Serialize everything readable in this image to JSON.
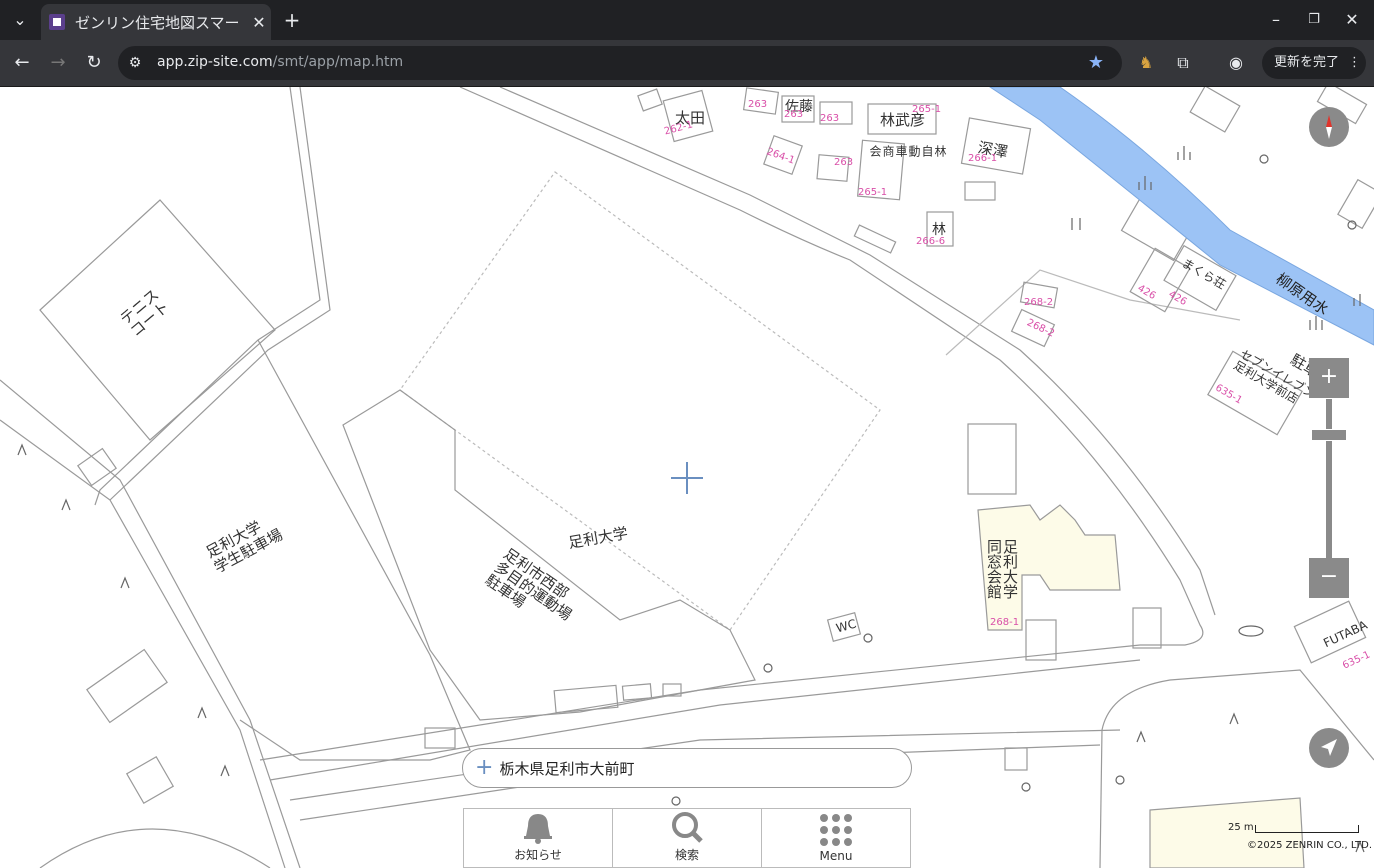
{
  "browser": {
    "tab_title": "ゼンリン住宅地図スマー",
    "url_host": "app.zip-site.com",
    "url_path": "/smt/app/map.htm",
    "update_label": "更新を完了"
  },
  "map": {
    "labels": {
      "tennis": "テニス\nコート",
      "parking": "足利大学\n学生駐車場",
      "university": "足利大学",
      "sports": "足利市西部\n多目的運動場\n駐車場",
      "alumni": "足利大学\n同窓会館",
      "ota": "太田",
      "sato": "佐藤",
      "hayashi_takehiko": "林武彦",
      "hayashi_shokai": "林\n自\n動\n車\n商\n会",
      "fukasawa": "深澤",
      "hayashi": "林",
      "seven": "セブンイレブン\n足利大学前店",
      "futaba": "FUTABA",
      "makura": "まくら荘",
      "wc": "WC",
      "canal": "柳原用水",
      "parking_right": "駐車"
    },
    "lot_numbers": [
      "262-1",
      "263",
      "263",
      "263",
      "263",
      "264-1",
      "263",
      "265-1",
      "265-1",
      "266-1",
      "266-6",
      "268-2",
      "268-2",
      "268-1",
      "426",
      "426",
      "635-1",
      "635-1"
    ]
  },
  "controls": {
    "zoom_in": "+",
    "zoom_out": "−"
  },
  "address": {
    "text": "栃木県足利市大前町"
  },
  "bottom_nav": {
    "notice": "お知らせ",
    "search": "検索",
    "menu": "Menu"
  },
  "scale": "25 m",
  "copyright": "©2025 ZENRIN CO., LTD."
}
